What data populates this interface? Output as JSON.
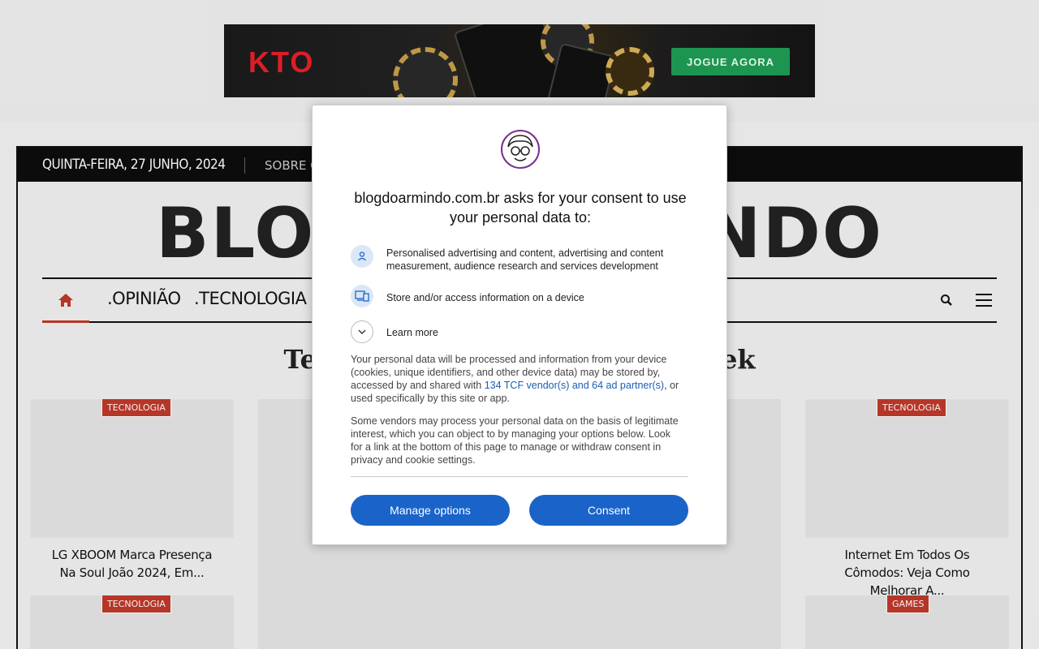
{
  "ad": {
    "logo_text": "KTO",
    "cta_label": "JOGUE AGORA",
    "colors": {
      "logo": "#e8202a",
      "cta": "#1f9d55"
    }
  },
  "site": {
    "date": "QUINTA-FEIRA, 27 JUNHO, 2024",
    "topbar_link": "SOBRE O",
    "logo_text": "BLOGDOARMINDO",
    "nav": {
      "home_icon": "home-icon",
      "items": [
        ".OPINIÃO",
        ".TECNOLOGIA"
      ],
      "dropdown_icon": "chevron-down-icon",
      "search_icon": "search-icon",
      "menu_icon": "hamburger-icon"
    },
    "section_title": "Tecnologia do Blog Of The Week",
    "posts": [
      {
        "tag": "TECNOLOGIA",
        "title": "LG XBOOM Marca Presença Na Soul João 2024, Em..."
      },
      {
        "tag": "TECNOLOGIA",
        "title": "Internet Em Todos Os Cômodos: Veja Como Melhorar A..."
      },
      {
        "tag": "TECNOLOGIA",
        "title": ""
      },
      {
        "tag": "GAMES",
        "title": ""
      }
    ],
    "accent_color": "#c0392b"
  },
  "consent": {
    "title": "blogdoarmindo.com.br asks for your consent to use your personal data to:",
    "purposes": [
      {
        "icon": "person-icon",
        "text": "Personalised advertising and content, advertising and content measurement, audience research and services development"
      },
      {
        "icon": "device-icon",
        "text": "Store and/or access information on a device"
      }
    ],
    "learn_more": "Learn more",
    "paragraph1_before": "Your personal data will be processed and information from your device (cookies, unique identifiers, and other device data) may be stored by, accessed by and shared with ",
    "paragraph1_link": "134 TCF vendor(s) and 64 ad partner(s)",
    "paragraph1_after": ", or used specifically by this site or app.",
    "paragraph2": "Some vendors may process your personal data on the basis of legitimate interest, which you can object to by managing your options below. Look for a link at the bottom of this page to manage or withdraw consent in privacy and cookie settings.",
    "manage_label": "Manage options",
    "consent_label": "Consent",
    "button_color": "#1a64c9"
  }
}
